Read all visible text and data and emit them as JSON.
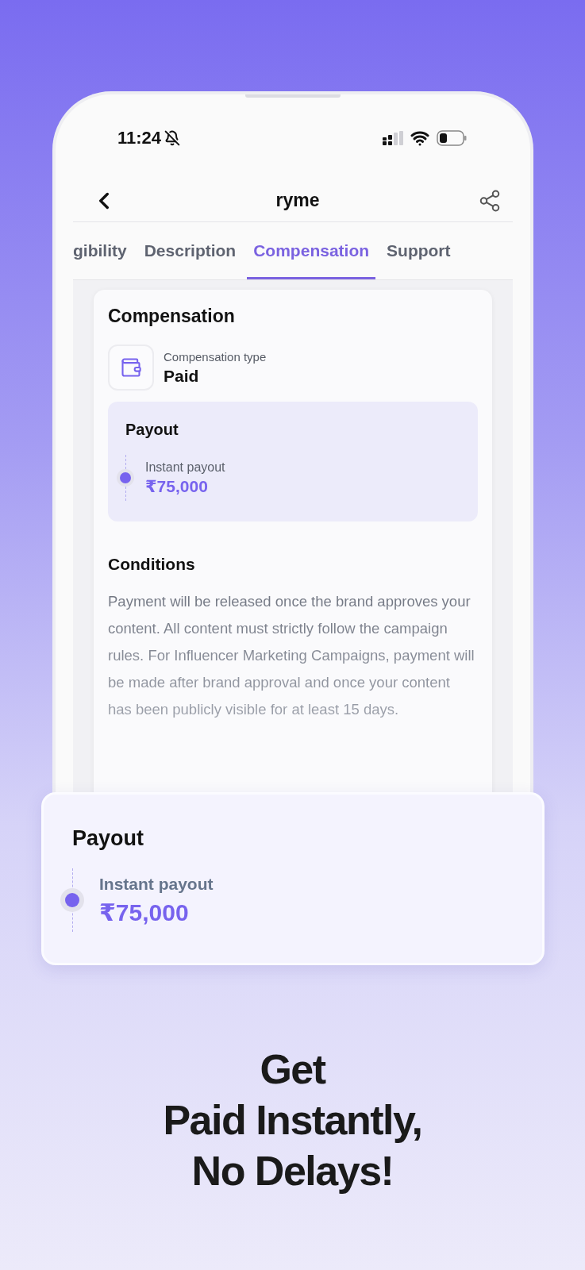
{
  "status_bar": {
    "time": "11:24"
  },
  "header": {
    "title": "ryme"
  },
  "tabs": [
    {
      "label": "gibility",
      "selected": false
    },
    {
      "label": "Description",
      "selected": false
    },
    {
      "label": "Compensation",
      "selected": true
    },
    {
      "label": "Support",
      "selected": false
    }
  ],
  "card": {
    "title": "Compensation",
    "type_label": "Compensation type",
    "type_value": "Paid",
    "payout": {
      "title": "Payout",
      "items": [
        {
          "label": "Instant payout",
          "amount": "₹75,000"
        }
      ]
    },
    "conditions": {
      "title": "Conditions",
      "text": "Payment will be released once the brand approves your content. All content must strictly follow the campaign rules. For Influencer Marketing Campaigns, payment will be made after brand approval and once your content has been publicly visible for at least 15 days."
    }
  },
  "overlay_card": {
    "title": "Payout",
    "items": [
      {
        "label": "Instant payout",
        "amount": "₹75,000"
      }
    ]
  },
  "headline_lines": [
    "Get",
    "Paid Instantly,",
    "No Delays!"
  ]
}
